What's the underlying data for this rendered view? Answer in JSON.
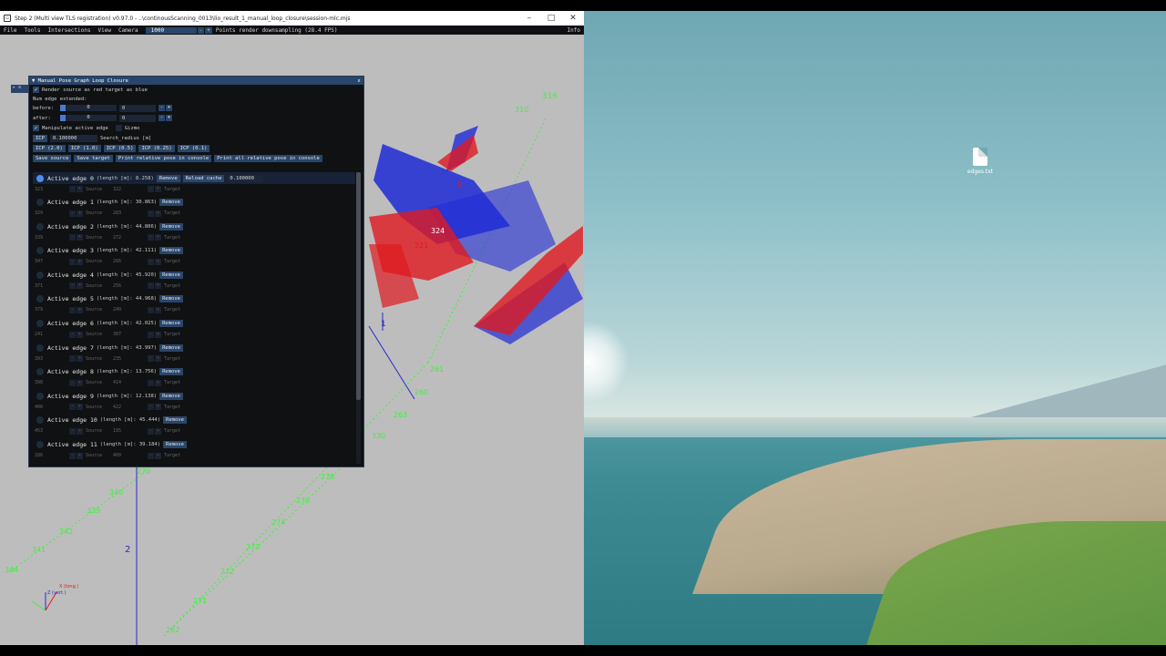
{
  "window": {
    "title": "Step 2 (Multi view TLS registration) v0.97.0 - ..\\continousScanning_0013\\lio_result_1_manual_loop_closure\\session-mlc.mjs",
    "minimize": "–",
    "maximize": "□",
    "close": "✕"
  },
  "menu": {
    "items": [
      "File",
      "Tools",
      "Intersections",
      "View",
      "Camera"
    ],
    "number": "1000",
    "minus": "-",
    "plus": "+",
    "status": "Points render downsampling (28.4 FPS)",
    "info": "Info"
  },
  "panel": {
    "title": "Manual Pose Graph Loop Closure",
    "close": "x",
    "render_label": "Render source as red target as blue",
    "num_edge": "Num edge extended:",
    "before_label": "before:",
    "after_label": "after:",
    "before_values": [
      "0",
      "0"
    ],
    "after_values": [
      "0",
      "0"
    ],
    "minus": "-",
    "plus": "+",
    "manipulate_label": "Manipulate active edge",
    "gizmo_label": "Gizmo",
    "icp_label": "ICP",
    "icp_value": "0.100000",
    "search_radius": "Search_radius [m]",
    "icp_buttons": [
      "ICP (2.0)",
      "ICP (1.0)",
      "ICP (0.5)",
      "ICP (0.25)",
      "ICP (0.1)"
    ],
    "action_buttons": [
      "Save source",
      "Save target",
      "Print relative pose in console",
      "Print all relative pose in console"
    ],
    "remove": "Remove",
    "reload_cache": "Reload cache",
    "cache_value": "0.100000",
    "source_label": "Source",
    "target_label": "Target",
    "edges": [
      {
        "label": "Active edge 0",
        "length": "(length [m]: 8.258)",
        "src": "323",
        "source": "322"
      },
      {
        "label": "Active edge 1",
        "length": "(length [m]: 30.863)",
        "src": "329",
        "source": "283"
      },
      {
        "label": "Active edge 2",
        "length": "(length [m]: 44.806)",
        "src": "339",
        "source": "272"
      },
      {
        "label": "Active edge 3",
        "length": "(length [m]: 42.111)",
        "src": "347",
        "source": "266"
      },
      {
        "label": "Active edge 4",
        "length": "(length [m]: 45.920)",
        "src": "371",
        "source": "256"
      },
      {
        "label": "Active edge 5",
        "length": "(length [m]: 44.968)",
        "src": "379",
        "source": "240"
      },
      {
        "label": "Active edge 6",
        "length": "(length [m]: 42.025)",
        "src": "241",
        "source": "387"
      },
      {
        "label": "Active edge 7",
        "length": "(length [m]: 43.997)",
        "src": "393",
        "source": "235"
      },
      {
        "label": "Active edge 8",
        "length": "(length [m]: 13.756)",
        "src": "398",
        "source": "414"
      },
      {
        "label": "Active edge 9",
        "length": "(length [m]: 12.138)",
        "src": "408",
        "source": "422"
      },
      {
        "label": "Active edge 10",
        "length": "(length [m]: 45.444)",
        "src": "453",
        "source": "195"
      },
      {
        "label": "Active edge 11",
        "length": "(length [m]: 39.184)",
        "src": "186",
        "source": "460"
      }
    ]
  },
  "scene": {
    "labels_green": [
      "316",
      "310",
      "340",
      "339",
      "342",
      "341",
      "344",
      "270",
      "278",
      "275",
      "274",
      "273",
      "272",
      "271",
      "262",
      "261",
      "260",
      "263",
      "330"
    ],
    "label_0": "0",
    "label_324": "324",
    "label_321": "321",
    "label_1": "1",
    "label_2": "2",
    "axis_x": "X (long.)",
    "axis_z": "Z (vert.)"
  },
  "desktop": {
    "file_name": "edges.txt"
  },
  "colors": {
    "accent": "#29456a",
    "red_points": "#e0191f",
    "blue_points": "#1f2bd6",
    "green_labels": "#3cf23c"
  }
}
